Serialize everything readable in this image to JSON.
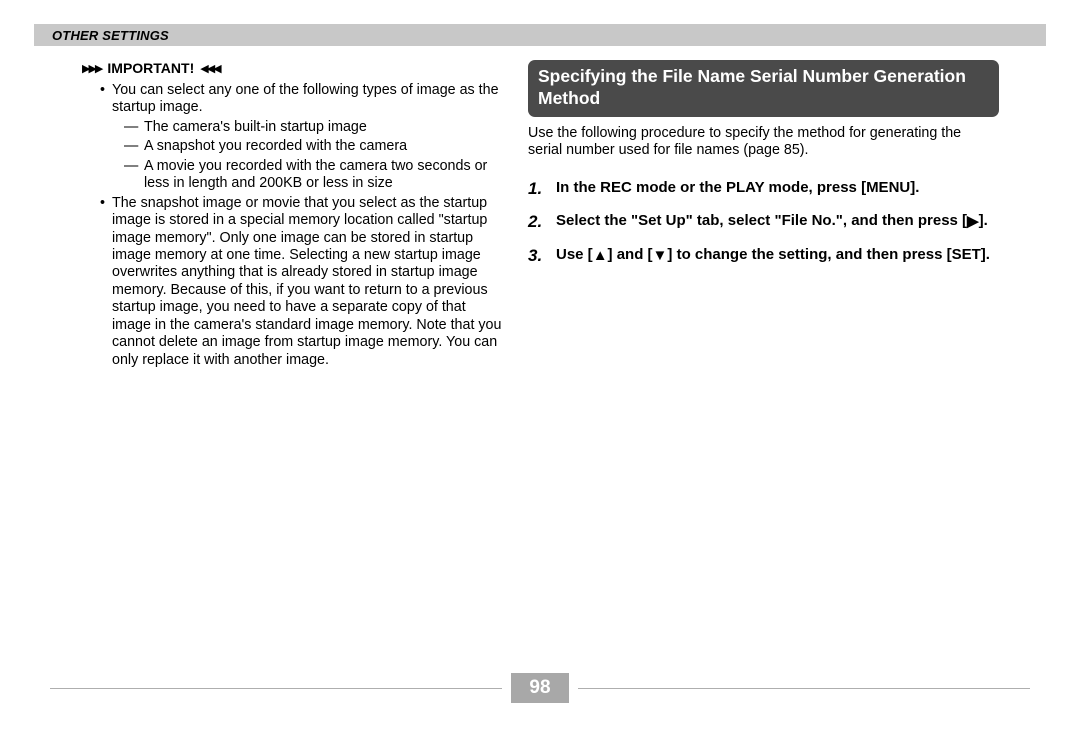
{
  "header": {
    "title": "OTHER SETTINGS"
  },
  "important": {
    "label": "IMPORTANT!",
    "bullets": [
      {
        "text": "You can select any one of the following types of image as the startup image.",
        "dashes": [
          "The camera's built-in startup image",
          "A snapshot you recorded with the camera",
          "A movie you recorded with the camera two seconds or less in length and 200KB or less in size"
        ]
      },
      {
        "text": "The snapshot image or movie that you select as the startup image is stored in a special memory location called \"startup image memory\". Only one image can be stored in startup image memory at one time. Selecting a new startup image overwrites anything that is already stored in startup image memory. Because of this, if you want to return to a previous startup image, you need to have a separate copy of that image in the camera's standard image memory. Note that you cannot delete an image from startup image memory. You can only replace it with another image."
      }
    ]
  },
  "section": {
    "title": "Specifying the File Name Serial Number Generation Method",
    "intro": "Use the following procedure to specify the method for generating the serial number used for file names (page 85).",
    "steps": {
      "s1": "In the REC mode or the PLAY mode, press [MENU].",
      "s2_a": "Select the \"Set Up\" tab, select \"File No.\", and then press [",
      "s2_b": "].",
      "s3_a": "Use [",
      "s3_b": "] and [",
      "s3_c": "] to change the setting, and then press [SET]."
    }
  },
  "pageNumber": "98"
}
